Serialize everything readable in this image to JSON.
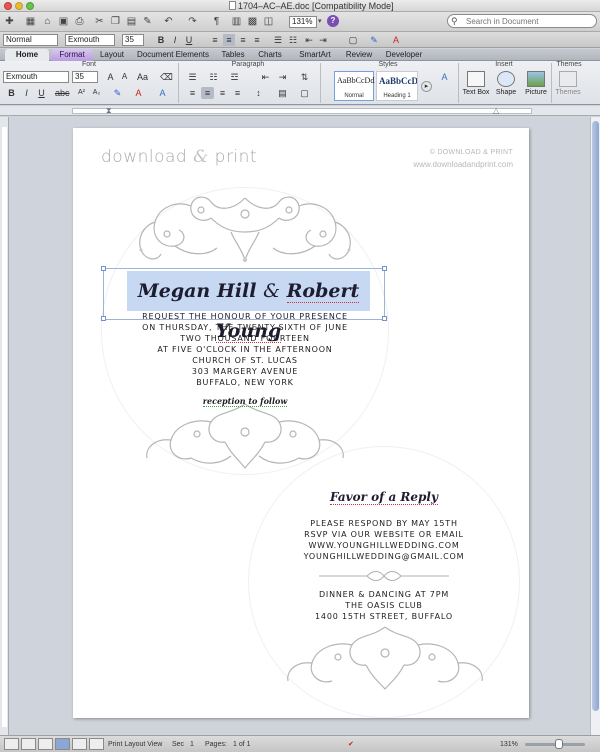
{
  "window": {
    "title": "1704–AC–AE.doc [Compatibility Mode]"
  },
  "toolbar": {
    "zoom": "131%",
    "search_placeholder": "Search in Document"
  },
  "format_bar": {
    "style": "Normal",
    "font": "Exmouth",
    "size": "35"
  },
  "ribbon": {
    "tabs": [
      "Home",
      "Format",
      "Layout",
      "Document Elements",
      "Tables",
      "Charts",
      "SmartArt",
      "Review",
      "Developer"
    ],
    "groups": {
      "font": "Font",
      "paragraph": "Paragraph",
      "styles": "Styles",
      "insert": "Insert",
      "themes": "Themes"
    },
    "font_name": "Exmouth",
    "font_size": "35",
    "style_normal_sample": "AaBbCcDdEe",
    "style_normal_name": "Normal",
    "style_heading_sample": "AaBbCcDc",
    "style_heading_name": "Heading 1",
    "insert": {
      "text_box": "Text Box",
      "shape": "Shape",
      "picture": "Picture"
    },
    "themes_label": "Themes"
  },
  "document": {
    "brand": {
      "word1": "download",
      "amp": "&",
      "word2": "print"
    },
    "copyright": "© DOWNLOAD & PRINT",
    "website": "www.downloadandprint.com",
    "names": {
      "partner1": "Megan Hill",
      "amp": "&",
      "partner2": "Robert Young"
    },
    "invitation_lines": [
      "REQUEST THE HONOUR OF YOUR PRESENCE",
      "ON THURSDAY, THE TWENTY-SIXTH OF JUNE",
      "TWO THOUSAND FOURTEEN",
      "AT FIVE O'CLOCK IN THE AFTERNOON",
      "CHURCH OF ST. LUCAS",
      "303 MARGERY AVENUE",
      "BUFFALO, NEW YORK"
    ],
    "reception": "reception to follow",
    "favor_title": "Favor of a Reply",
    "rsvp_lines": [
      "PLEASE RESPOND BY MAY 15TH",
      "RSVP VIA OUR WEBSITE OR EMAIL",
      "WWW.YOUNGHILLWEDDING.COM",
      "YOUNGHILLWEDDING@GMAIL.COM"
    ],
    "event_lines": [
      "DINNER & DANCING AT 7PM",
      "THE OASIS CLUB",
      "1400 15TH STREET, BUFFALO"
    ]
  },
  "statusbar": {
    "view": "Print Layout View",
    "sec_label": "Sec",
    "sec_value": "1",
    "pages_label": "Pages:",
    "pages_value": "1 of 1",
    "zoom": "131%"
  }
}
